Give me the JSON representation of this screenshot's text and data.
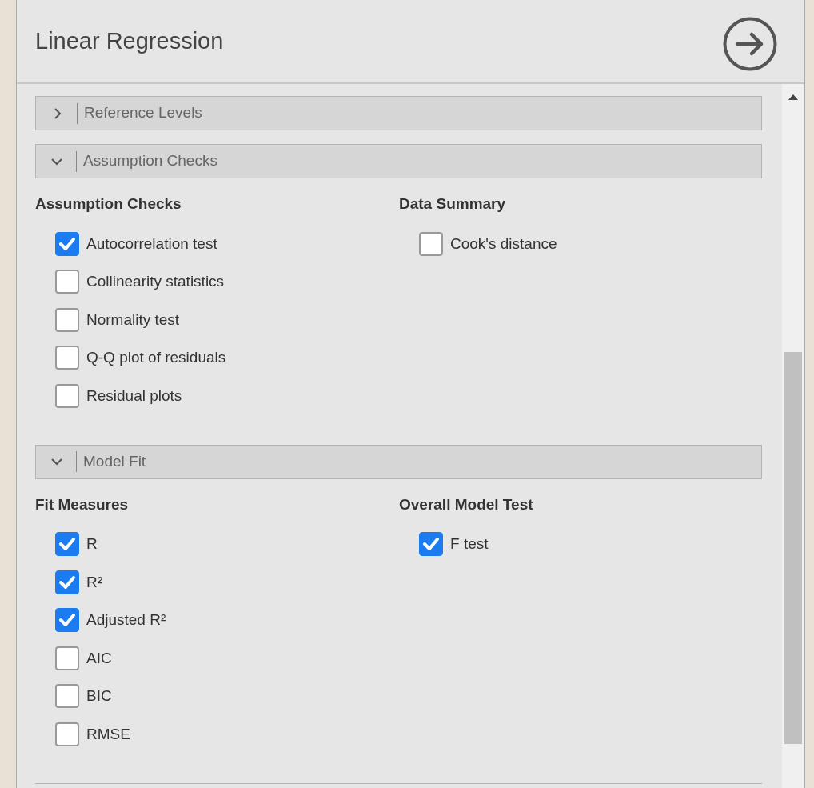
{
  "title": "Linear Regression",
  "sections": [
    {
      "title": "Reference Levels",
      "expanded": false
    },
    {
      "title": "Assumption Checks",
      "expanded": true,
      "groups": [
        {
          "heading": "Assumption Checks",
          "options": [
            {
              "label": "Autocorrelation test",
              "checked": true
            },
            {
              "label": "Collinearity statistics",
              "checked": false
            },
            {
              "label": "Normality test",
              "checked": false
            },
            {
              "label": "Q-Q plot of residuals",
              "checked": false
            },
            {
              "label": "Residual plots",
              "checked": false
            }
          ]
        },
        {
          "heading": "Data Summary",
          "options": [
            {
              "label": "Cook's distance",
              "checked": false
            }
          ]
        }
      ]
    },
    {
      "title": "Model Fit",
      "expanded": true,
      "groups": [
        {
          "heading": "Fit Measures",
          "options": [
            {
              "label": "R",
              "checked": true
            },
            {
              "label": "R²",
              "checked": true
            },
            {
              "label": "Adjusted R²",
              "checked": true
            },
            {
              "label": "AIC",
              "checked": false
            },
            {
              "label": "BIC",
              "checked": false
            },
            {
              "label": "RMSE",
              "checked": false
            }
          ]
        },
        {
          "heading": "Overall Model Test",
          "options": [
            {
              "label": "F test",
              "checked": true
            }
          ]
        }
      ]
    }
  ]
}
